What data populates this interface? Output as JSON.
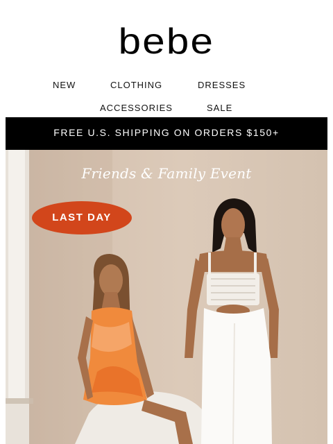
{
  "brand": {
    "logo_text": "bebe"
  },
  "nav": {
    "items": [
      {
        "label": "NEW"
      },
      {
        "label": "CLOTHING"
      },
      {
        "label": "DRESSES"
      },
      {
        "label": "ACCESSORIES"
      },
      {
        "label": "SALE"
      }
    ]
  },
  "promo_bar": {
    "text": "FREE U.S. SHIPPING ON ORDERS $150+"
  },
  "hero": {
    "event_title": "Friends & Family Event",
    "badge_text": "LAST DAY",
    "badge_color": "#d2461b"
  }
}
